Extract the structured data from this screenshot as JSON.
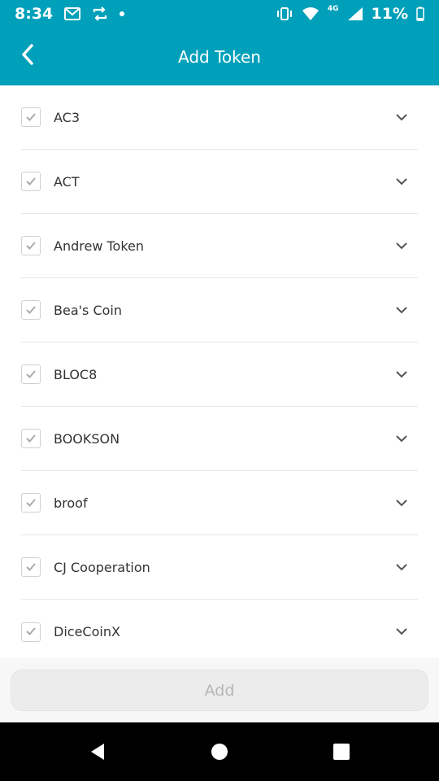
{
  "status_bar": {
    "time": "8:34",
    "network_label": "4G",
    "battery": "11%",
    "icons": [
      "gmail-icon",
      "sync-icon",
      "dot-icon",
      "vibrate-icon",
      "wifi-icon",
      "signal-icon",
      "battery-icon"
    ]
  },
  "header": {
    "title": "Add Token",
    "back_icon": "chevron-left-icon",
    "color": "#00a0ba"
  },
  "tokens": [
    {
      "name": "AC3",
      "checked": true
    },
    {
      "name": "ACT",
      "checked": true
    },
    {
      "name": "Andrew Token",
      "checked": true
    },
    {
      "name": "Bea's Coin",
      "checked": true
    },
    {
      "name": "BLOC8",
      "checked": true
    },
    {
      "name": "BOOKSON",
      "checked": true
    },
    {
      "name": "broof",
      "checked": true
    },
    {
      "name": "CJ Cooperation",
      "checked": true
    },
    {
      "name": "DiceCoinX",
      "checked": true
    }
  ],
  "footer": {
    "add_label": "Add"
  },
  "navigation": {
    "icons": [
      "back-triangle-icon",
      "home-circle-icon",
      "recents-square-icon"
    ]
  }
}
